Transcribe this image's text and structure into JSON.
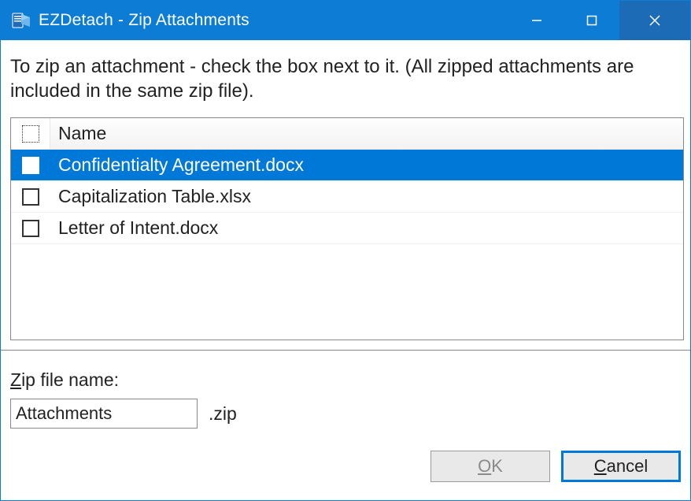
{
  "window": {
    "title": "EZDetach - Zip Attachments"
  },
  "instruction": "To zip an attachment - check the box next to it. (All zipped attachments are included in the same zip file).",
  "list": {
    "header": {
      "name_label": "Name"
    },
    "rows": [
      {
        "name": "Confidentialty Agreement.docx",
        "selected": true,
        "checked": false
      },
      {
        "name": "Capitalization Table.xlsx",
        "selected": false,
        "checked": false
      },
      {
        "name": "Letter of Intent.docx",
        "selected": false,
        "checked": false
      }
    ]
  },
  "zip": {
    "label_before": "Z",
    "label_after": "ip file name:",
    "value": "Attachments",
    "ext": ".zip"
  },
  "buttons": {
    "ok_u": "O",
    "ok_after": "K",
    "cancel_u": "C",
    "cancel_after": "ancel"
  }
}
